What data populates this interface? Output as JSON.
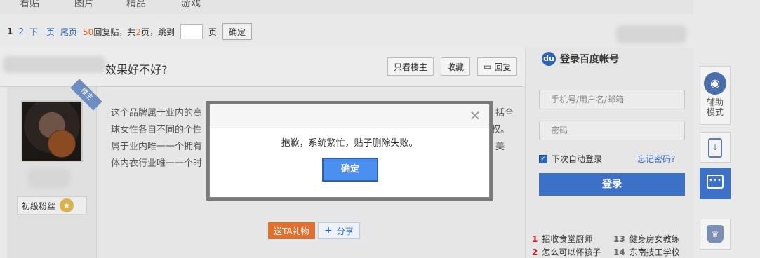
{
  "tabs": [
    "看贴",
    "图片",
    "精品",
    "游戏"
  ],
  "pager": {
    "current": "1",
    "page2": "2",
    "next": "下一页",
    "last": "尾页",
    "reply_count": "50",
    "reply_text": "回复贴，共",
    "pages": "2",
    "pages_suffix": "页，跳到",
    "page_unit": "页",
    "confirm": "确定"
  },
  "topic": {
    "title": "效果好不好?",
    "only_op": "只看楼主",
    "favorite": "收藏",
    "reply": "回复"
  },
  "post": {
    "badge": "楼主",
    "level": "初级粉丝",
    "level_icon": "star-badge-icon",
    "lines": [
      "这个品牌属于业内的高",
      "球女性各自不同的个性",
      "属于业内唯一一个拥有",
      "体内衣行业唯一一个时"
    ],
    "right_fragments": [
      "括全",
      "权。",
      "美"
    ],
    "gift": "送TA礼物",
    "share": "分享"
  },
  "login": {
    "title": "登录百度帐号",
    "username_placeholder": "手机号/用户名/邮箱",
    "password_placeholder": "密码",
    "remember": "下次自动登录",
    "forgot": "忘记密码?",
    "submit": "登录"
  },
  "hot": [
    {
      "n": "1",
      "text": "招收食堂厨师"
    },
    {
      "n": "13",
      "text": "健身房女教练"
    },
    {
      "n": "2",
      "text": "怎么可以怀孩子"
    },
    {
      "n": "14",
      "text": "东南技工学校"
    }
  ],
  "rail": {
    "assist_label": "辅助模式"
  },
  "dialog": {
    "message": "抱歉，系统繁忙，贴子删除失败。",
    "ok": "确定"
  },
  "colors": {
    "link": "#2d64b3",
    "accent_orange": "#e07030",
    "login_button": "#3d70c7",
    "dialog_button": "#4b8ff0"
  }
}
